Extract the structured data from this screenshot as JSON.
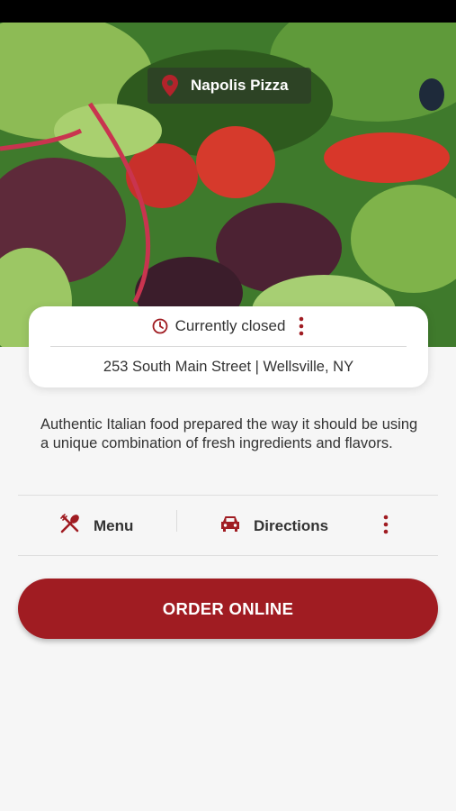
{
  "header": {
    "place_name": "Napolis Pizza"
  },
  "info": {
    "status": "Currently closed",
    "address": "253 South Main Street | Wellsville, NY"
  },
  "description": "Authentic Italian food prepared the way it should be using a unique combination of fresh ingredients and flavors.",
  "actions": {
    "menu_label": "Menu",
    "directions_label": "Directions"
  },
  "order": {
    "label": "ORDER ONLINE"
  },
  "colors": {
    "accent": "#a01c22",
    "background": "#f6f6f6"
  },
  "icons": {
    "pin": "map-pin-icon",
    "clock": "clock-icon",
    "more": "more-vertical-icon",
    "menu": "fork-spoon-icon",
    "directions": "car-icon"
  }
}
